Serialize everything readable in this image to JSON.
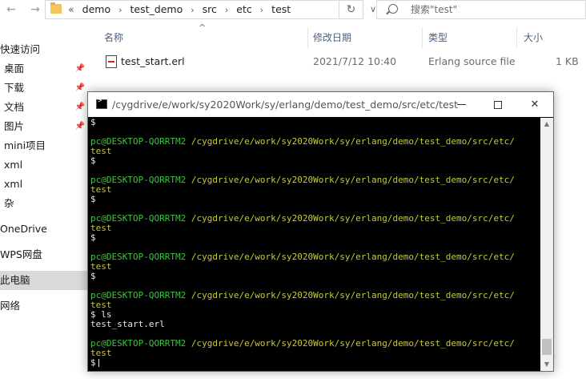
{
  "explorer": {
    "nav": {
      "back_icon": "arrow-left-icon",
      "forward_icon": "arrow-right-icon"
    },
    "address": {
      "lead": "«",
      "crumbs": [
        "demo",
        "test_demo",
        "src",
        "etc",
        "test"
      ],
      "separator": "›",
      "dropdown_icon": "∨",
      "refresh_icon": "↻"
    },
    "search": {
      "placeholder": "搜索\"test\""
    },
    "columns": {
      "name": "名称",
      "date": "修改日期",
      "type": "类型",
      "size": "大小",
      "sort_indicator": "^"
    },
    "files": [
      {
        "name": "test_start.erl",
        "date": "2021/7/12 10:40",
        "type": "Erlang source file",
        "size": "1 KB"
      }
    ],
    "sidebar": [
      {
        "label": "快速访问",
        "pinned": false,
        "selected": false
      },
      {
        "label": "桌面",
        "pinned": true,
        "selected": false
      },
      {
        "label": "下载",
        "pinned": true,
        "selected": false
      },
      {
        "label": "文档",
        "pinned": true,
        "selected": false
      },
      {
        "label": "图片",
        "pinned": true,
        "selected": false
      },
      {
        "label": "mini项目",
        "pinned": false,
        "selected": false
      },
      {
        "label": "xml",
        "pinned": false,
        "selected": false
      },
      {
        "label": "xml",
        "pinned": false,
        "selected": false
      },
      {
        "label": "杂",
        "pinned": false,
        "selected": false
      },
      {
        "label": "OneDrive",
        "pinned": false,
        "selected": false
      },
      {
        "label": "WPS网盘",
        "pinned": false,
        "selected": false
      },
      {
        "label": "此电脑",
        "pinned": false,
        "selected": true
      },
      {
        "label": "网络",
        "pinned": false,
        "selected": false
      }
    ]
  },
  "terminal": {
    "title": "/cygdrive/e/work/sy2020Work/sy/erlang/demo/test_demo/src/etc/test",
    "controls": {
      "minimize": "minimize-icon",
      "maximize": "maximize-icon",
      "close": "✕"
    },
    "prompt_user": "pc@DESKTOP-QORRTM2",
    "prompt_path": " /cygdrive/e/work/sy2020Work/sy/erlang/demo/test_demo/src/etc/",
    "prompt_tail": "test",
    "dollar": "$",
    "ls_command": "$ ls",
    "ls_output": "test_start.erl",
    "final_prompt": "$"
  },
  "colors": {
    "prompt_user": "#3cc33c",
    "prompt_path": "#c8c83c",
    "terminal_text": "#e6e6e6",
    "terminal_bg": "#000000",
    "column_header": "#4c607a"
  }
}
